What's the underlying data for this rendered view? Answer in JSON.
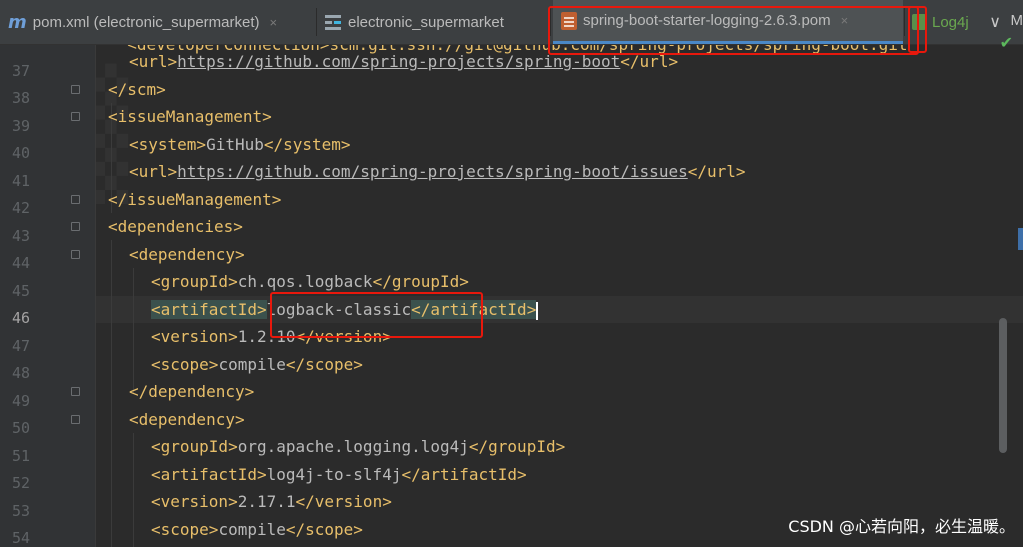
{
  "tabs": [
    {
      "label": "pom.xml (electronic_supermarket)",
      "icon": "maven-m-icon",
      "active": false
    },
    {
      "label": "electronic_supermarket",
      "icon": "project-structure-icon",
      "active": false
    },
    {
      "label": "spring-boot-starter-logging-2.6.3.pom",
      "icon": "pom-file-icon",
      "active": true
    },
    {
      "label": "Log4j",
      "icon": "log-file-icon",
      "active": false
    }
  ],
  "tab_close_glyph": "×",
  "tab_overflow": {
    "chevron": "∨",
    "more": "M"
  },
  "editor": {
    "current_line": 46,
    "line_numbers": [
      "37",
      "38",
      "39",
      "40",
      "41",
      "42",
      "43",
      "44",
      "45",
      "46",
      "47",
      "48",
      "49",
      "50",
      "51",
      "52",
      "53",
      "54"
    ],
    "partial_top_line": "  <developerConnection>scm:git:ssh://git@github.com/spring-projects/spring-boot.git",
    "lines": [
      {
        "n": "37",
        "indent": "  ",
        "open": "<url>",
        "text": "https://github.com/spring-projects/spring-boot",
        "close": "</url>",
        "link": true
      },
      {
        "n": "38",
        "indent": "",
        "open": "</scm>",
        "text": "",
        "close": ""
      },
      {
        "n": "39",
        "indent": "",
        "open": "<issueManagement>",
        "text": "",
        "close": ""
      },
      {
        "n": "40",
        "indent": "  ",
        "open": "<system>",
        "text": "GitHub",
        "close": "</system>"
      },
      {
        "n": "41",
        "indent": "  ",
        "open": "<url>",
        "text": "https://github.com/spring-projects/spring-boot/issues",
        "close": "</url>",
        "link": true
      },
      {
        "n": "42",
        "indent": "",
        "open": "</issueManagement>",
        "text": "",
        "close": ""
      },
      {
        "n": "43",
        "indent": "",
        "open": "<dependencies>",
        "text": "",
        "close": ""
      },
      {
        "n": "44",
        "indent": "  ",
        "open": "<dependency>",
        "text": "",
        "close": ""
      },
      {
        "n": "45",
        "indent": "    ",
        "open": "<groupId>",
        "text": "ch.qos.logback",
        "close": "</groupId>"
      },
      {
        "n": "46",
        "indent": "    ",
        "open": "<artifactId>",
        "text": "logback-classic",
        "close": "</artifactId>",
        "current": true
      },
      {
        "n": "47",
        "indent": "    ",
        "open": "<version>",
        "text": "1.2.10",
        "close": "</version>"
      },
      {
        "n": "48",
        "indent": "    ",
        "open": "<scope>",
        "text": "compile",
        "close": "</scope>"
      },
      {
        "n": "49",
        "indent": "  ",
        "open": "</dependency>",
        "text": "",
        "close": ""
      },
      {
        "n": "50",
        "indent": "  ",
        "open": "<dependency>",
        "text": "",
        "close": ""
      },
      {
        "n": "51",
        "indent": "    ",
        "open": "<groupId>",
        "text": "org.apache.logging.log4j",
        "close": "</groupId>"
      },
      {
        "n": "52",
        "indent": "    ",
        "open": "<artifactId>",
        "text": "log4j-to-slf4j",
        "close": "</artifactId>"
      },
      {
        "n": "53",
        "indent": "    ",
        "open": "<version>",
        "text": "2.17.1",
        "close": "</version>"
      },
      {
        "n": "54",
        "indent": "    ",
        "open": "<scope>",
        "text": "compile",
        "close": "</scope>"
      }
    ]
  },
  "inspection_status": "✔",
  "watermark": "CSDN @心若向阳，必生温暖。",
  "colors": {
    "background": "#2b2b2b",
    "tag": "#e8bf6a",
    "text": "#bababa",
    "annotation_red": "#e8180c",
    "active_tab_underline": "#4a88c7"
  }
}
